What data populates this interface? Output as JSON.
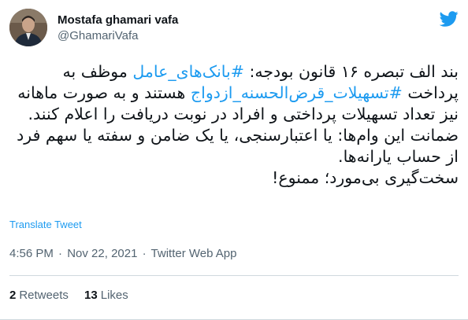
{
  "tweet": {
    "author": {
      "display_name": "Mostafa ghamari vafa",
      "handle": "@GhamariVafa"
    },
    "platform_icon": "twitter-bird-icon",
    "body": {
      "p1_part1": "بند الف تبصره ۱۶ قانون بودجه: ",
      "hashtag1": "#بانک‌های_عامل",
      "p1_part2": " موظف به پرداخت ",
      "hashtag2": "#تسهیلات_قرض‌الحسنه_ازدواج",
      "p1_part3": " هستند و به صورت ماهانه نیز تعداد تسهیلات پرداختی و افراد در نوبت دریافت را اعلام کنند.",
      "p2": "ضمانت این وام‌ها: یا اعتبارسنجی، یا یک ضامن و سفته یا سهم فرد از حساب یارانه‌ها.",
      "p3": "سخت‌گیری بی‌مورد؛ ممنوع!"
    },
    "translate_label": "Translate Tweet",
    "time": "4:56 PM",
    "separator": "·",
    "date": "Nov 22, 2021",
    "source": "Twitter Web App",
    "retweets": {
      "count": "2",
      "label": "Retweets"
    },
    "likes": {
      "count": "13",
      "label": "Likes"
    }
  },
  "colors": {
    "accent": "#1d9bf0",
    "text": "#0f1419",
    "secondary": "#536471",
    "border": "#cfd9de"
  }
}
